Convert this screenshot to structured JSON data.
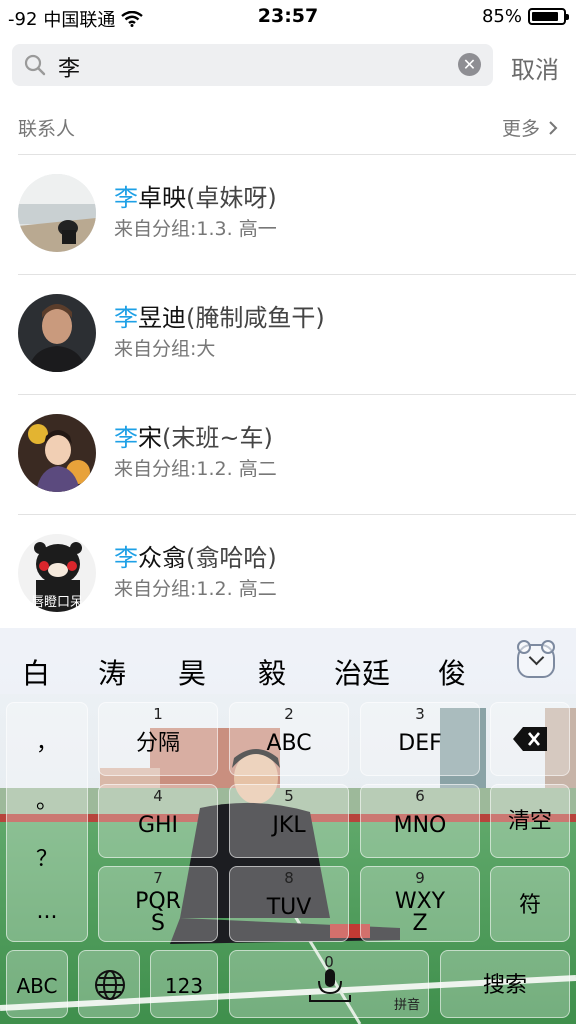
{
  "status_bar": {
    "signal": "-92",
    "carrier": "中国联通",
    "time": "23:57",
    "battery": "85%",
    "battery_level": 0.85
  },
  "search": {
    "query": "李",
    "cancel_label": "取消"
  },
  "section": {
    "title": "联系人",
    "more_label": "更多"
  },
  "contacts": [
    {
      "highlight": "李",
      "name": "卓映",
      "nickname": "(卓妹呀)",
      "group": "来自分组:1.3. 高一"
    },
    {
      "highlight": "李",
      "name": "昱迪",
      "nickname": "(腌制咸鱼干)",
      "group": "来自分组:大"
    },
    {
      "highlight": "李",
      "name": "宋",
      "nickname": "(末班~车)",
      "group": "来自分组:1.2. 高二"
    },
    {
      "highlight": "李",
      "name": "众翕",
      "nickname": "(翕哈哈)",
      "group": "来自分组:1.2. 高二",
      "avatar_caption": "唇瞪口呆"
    }
  ],
  "keyboard": {
    "candidates": [
      "白",
      "涛",
      "昊",
      "毅",
      "治廷",
      "俊"
    ],
    "punct_keys": [
      "，",
      "。",
      "？",
      "..."
    ],
    "keys": [
      {
        "num": "1",
        "label": "分隔"
      },
      {
        "num": "2",
        "label": "ABC"
      },
      {
        "num": "3",
        "label": "DEF"
      },
      {
        "num": "4",
        "label": "GHI"
      },
      {
        "num": "5",
        "label": "JKL"
      },
      {
        "num": "6",
        "label": "MNO"
      },
      {
        "num": "7",
        "label": "PQR\nS"
      },
      {
        "num": "8",
        "label": "TUV"
      },
      {
        "num": "9",
        "label": "WXY\nZ"
      }
    ],
    "clear_label": "清空",
    "symbol_label": "符",
    "abc_label": "ABC",
    "num_label": "123",
    "space_num": "0",
    "space_label": "拼音",
    "search_label": "搜索"
  },
  "colors": {
    "highlight": "#1ea0e6",
    "search_bg": "#eeeff1",
    "muted": "#777777"
  }
}
